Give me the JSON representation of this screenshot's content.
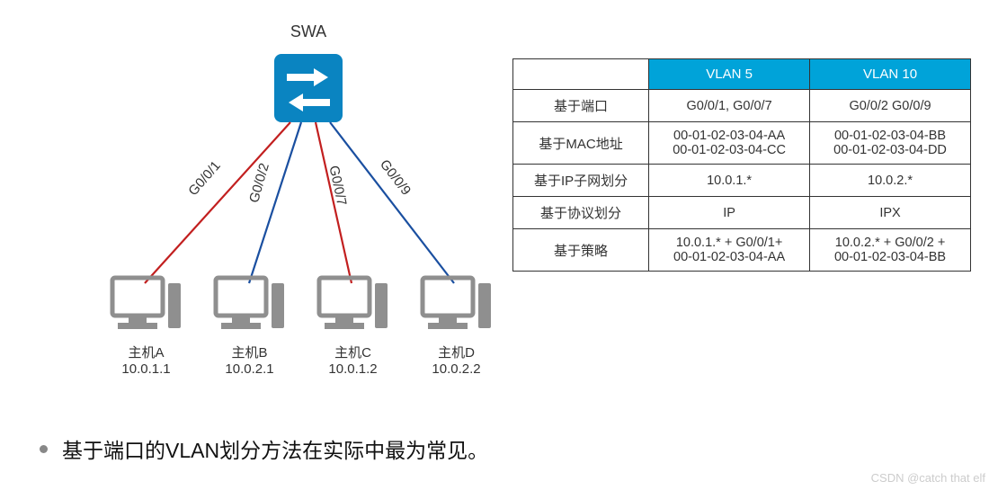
{
  "diagram": {
    "switch_label": "SWA",
    "ports": [
      {
        "name": "G0/0/1",
        "color": "#c21f1f"
      },
      {
        "name": "G0/0/2",
        "color": "#1a4fa0"
      },
      {
        "name": "G0/0/7",
        "color": "#c21f1f"
      },
      {
        "name": "G0/0/9",
        "color": "#1a4fa0"
      }
    ],
    "hosts": [
      {
        "label": "主机A",
        "ip": "10.0.1.1"
      },
      {
        "label": "主机B",
        "ip": "10.0.2.1"
      },
      {
        "label": "主机C",
        "ip": "10.0.1.2"
      },
      {
        "label": "主机D",
        "ip": "10.0.2.2"
      }
    ]
  },
  "table": {
    "headers": {
      "blank": "",
      "col1": "VLAN 5",
      "col2": "VLAN 10"
    },
    "rows": [
      {
        "head": "基于端口",
        "c1": "G0/0/1, G0/0/7",
        "c2": "G0/0/2 G0/0/9"
      },
      {
        "head": "基于MAC地址",
        "c1": "00-01-02-03-04-AA\n00-01-02-03-04-CC",
        "c2": "00-01-02-03-04-BB\n00-01-02-03-04-DD"
      },
      {
        "head": "基于IP子网划分",
        "c1": "10.0.1.*",
        "c2": "10.0.2.*"
      },
      {
        "head": "基于协议划分",
        "c1": "IP",
        "c2": "IPX"
      },
      {
        "head": "基于策略",
        "c1": "10.0.1.* + G0/0/1+\n00-01-02-03-04-AA",
        "c2": "10.0.2.* + G0/0/2 +\n00-01-02-03-04-BB"
      }
    ]
  },
  "bullet": "基于端口的VLAN划分方法在实际中最为常见。",
  "watermark": "CSDN @catch that elf"
}
